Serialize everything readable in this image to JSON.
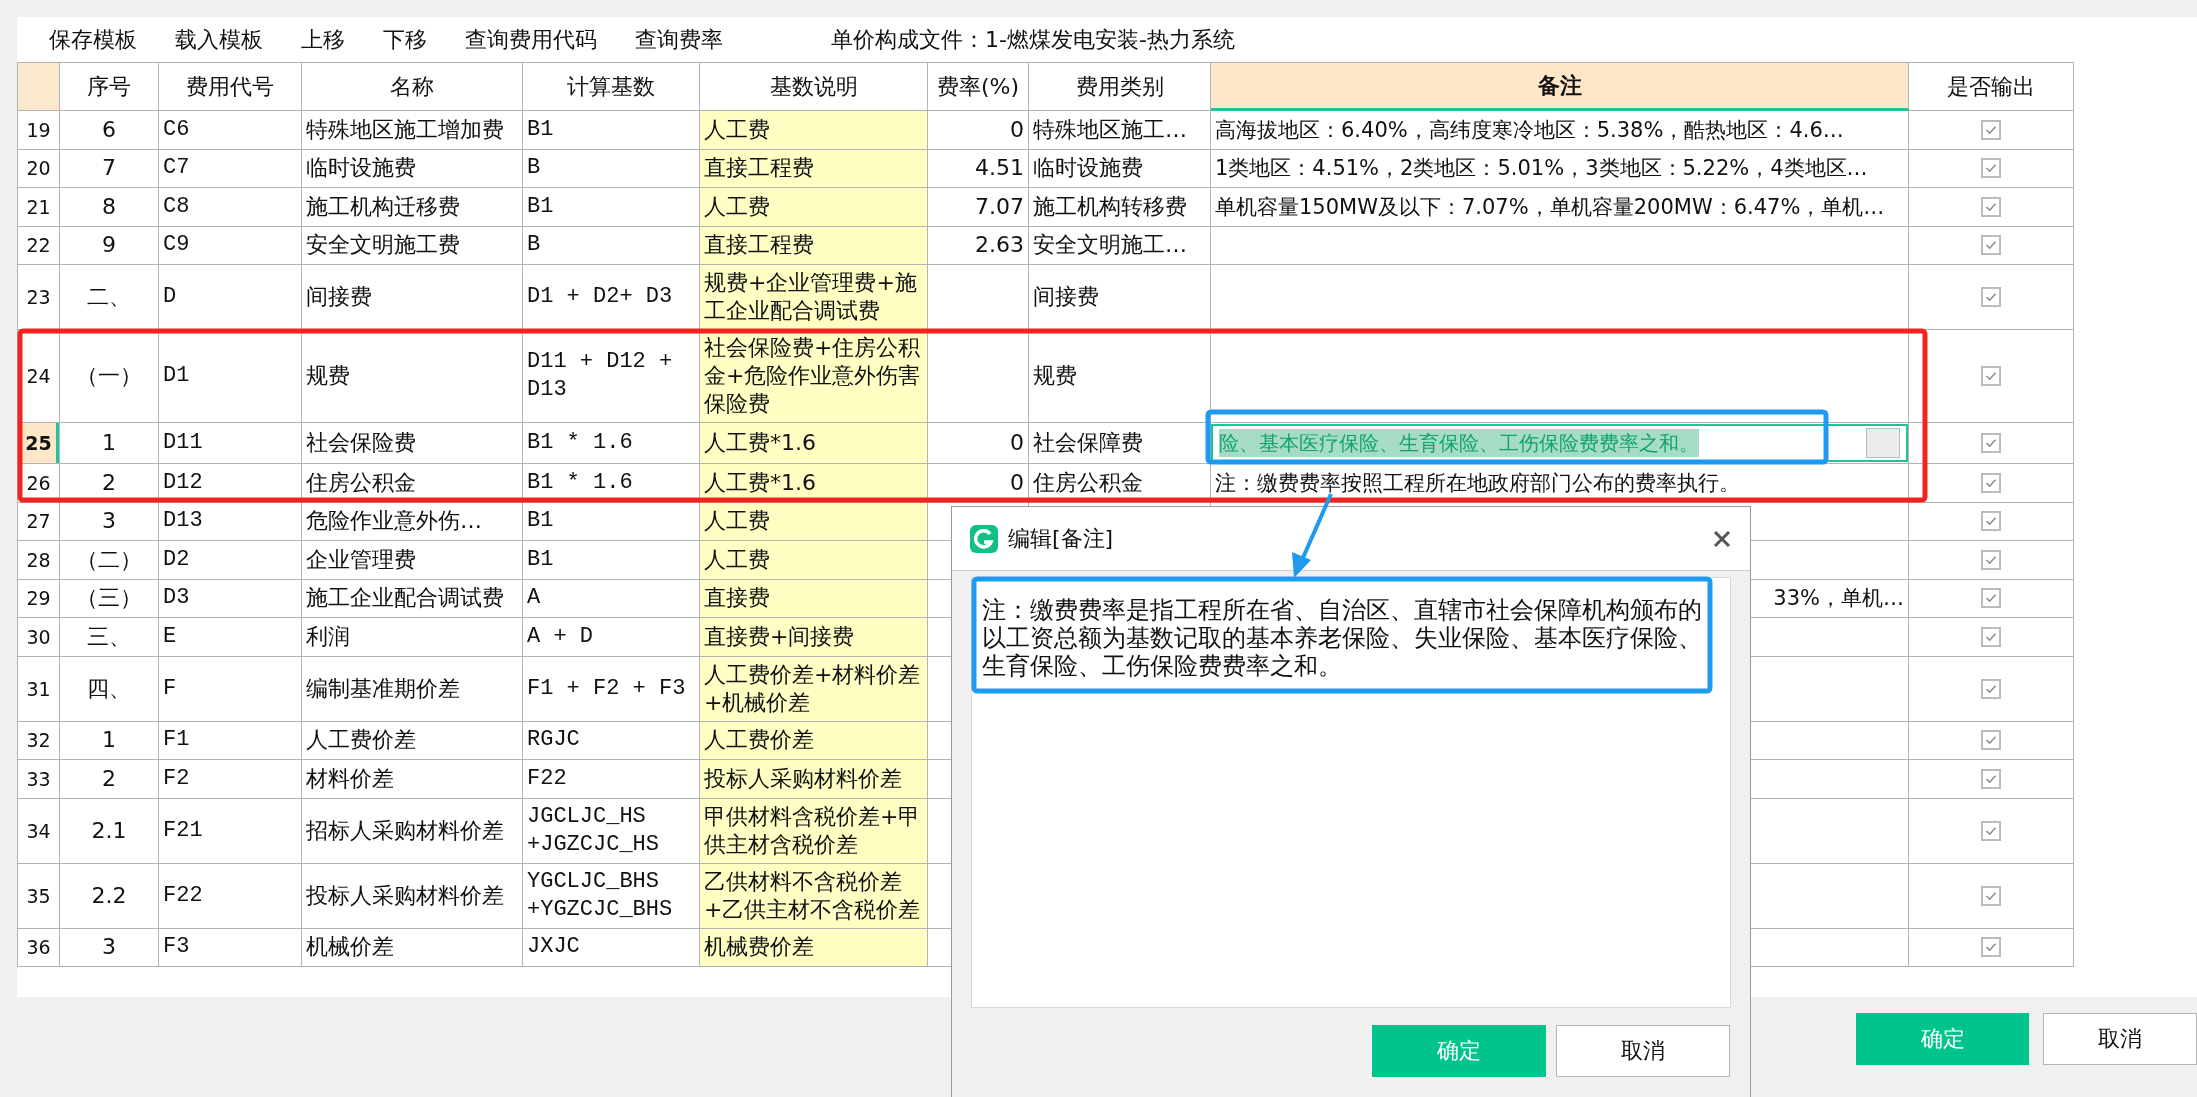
{
  "toolbar": {
    "buttons": [
      "保存模板",
      "载入模板",
      "上移",
      "下移",
      "查询费用代码",
      "查询费率"
    ],
    "file_label": "单价构成文件：1-燃煤发电安装-热力系统"
  },
  "table": {
    "columns": [
      {
        "label": "序号",
        "selected": false
      },
      {
        "label": "费用代号",
        "selected": false
      },
      {
        "label": "名称",
        "selected": false
      },
      {
        "label": "计算基数",
        "selected": false
      },
      {
        "label": "基数说明",
        "selected": false
      },
      {
        "label": "费率(%)",
        "selected": false
      },
      {
        "label": "费用类别",
        "selected": false
      },
      {
        "label": "备注",
        "selected": true
      },
      {
        "label": "是否输出",
        "selected": false
      }
    ],
    "rows": [
      {
        "n": "19",
        "seq": "6",
        "code": "C6",
        "name": "特殊地区施工增加费",
        "base": "B1",
        "base_desc": "人工费",
        "rate": "0",
        "category": "特殊地区施工…",
        "remark": "高海拔地区：6.40%，高纬度寒冷地区：5.38%，酷热地区：4.6…",
        "output": true,
        "selected": false
      },
      {
        "n": "20",
        "seq": "7",
        "code": "C7",
        "name": "临时设施费",
        "base": "B",
        "base_desc": "直接工程费",
        "rate": "4.51",
        "category": "临时设施费",
        "remark": "1类地区：4.51%，2类地区：5.01%，3类地区：5.22%，4类地区…",
        "output": true,
        "selected": false
      },
      {
        "n": "21",
        "seq": "8",
        "code": "C8",
        "name": "施工机构迁移费",
        "base": "B1",
        "base_desc": "人工费",
        "rate": "7.07",
        "category": "施工机构转移费",
        "remark": "单机容量150MW及以下：7.07%，单机容量200MW：6.47%，单机…",
        "output": true,
        "selected": false
      },
      {
        "n": "22",
        "seq": "9",
        "code": "C9",
        "name": "安全文明施工费",
        "base": "B",
        "base_desc": "直接工程费",
        "rate": "2.63",
        "category": "安全文明施工…",
        "output": true,
        "selected": false
      },
      {
        "n": "23",
        "seq": "二、",
        "code": "D",
        "name": "间接费",
        "base": "D1 + D2+ D3",
        "base_desc": "规费+企业管理费+施工企业配合调试费",
        "category": "间接费",
        "output": true,
        "selected": false
      },
      {
        "n": "24",
        "seq": "（一）",
        "code": "D1",
        "name": "规费",
        "base": "D11 + D12 + D13",
        "base_desc": "社会保险费+住房公积金+危险作业意外伤害保险费",
        "category": "规费",
        "output": true,
        "selected": false
      },
      {
        "n": "25",
        "seq": "1",
        "code": "D11",
        "name": "社会保险费",
        "base": "B1 * 1.6",
        "base_desc": "人工费*1.6",
        "rate": "0",
        "category": "社会保障费",
        "remark": "险、基本医疗保险、生育保险、工伤保险费费率之和。",
        "output": true,
        "selected": true
      },
      {
        "n": "26",
        "seq": "2",
        "code": "D12",
        "name": "住房公积金",
        "base": "B1 * 1.6",
        "base_desc": "人工费*1.6",
        "rate": "0",
        "category": "住房公积金",
        "remark": "注：缴费费率按照工程所在地政府部门公布的费率执行。",
        "output": true,
        "selected": false
      },
      {
        "n": "27",
        "seq": "3",
        "code": "D13",
        "name": "危险作业意外伤…",
        "base": "B1",
        "base_desc": "人工费",
        "output": true,
        "selected": false
      },
      {
        "n": "28",
        "seq": "（二）",
        "code": "D2",
        "name": "企业管理费",
        "base": "B1",
        "base_desc": "人工费",
        "output": true,
        "selected": false
      },
      {
        "n": "29",
        "seq": "（三）",
        "code": "D3",
        "name": "施工企业配合调试费",
        "base": "A",
        "base_desc": "直接费",
        "remark_tail": "33%，单机…",
        "output": true,
        "selected": false
      },
      {
        "n": "30",
        "seq": "三、",
        "code": "E",
        "name": "利润",
        "base": "A + D",
        "base_desc": "直接费+间接费",
        "output": true,
        "selected": false
      },
      {
        "n": "31",
        "seq": "四、",
        "code": "F",
        "name": "编制基准期价差",
        "base": "F1 + F2 + F3",
        "base_desc": "人工费价差+材料价差+机械价差",
        "output": true,
        "selected": false
      },
      {
        "n": "32",
        "seq": "1",
        "code": "F1",
        "name": "人工费价差",
        "base": "RGJC",
        "base_desc": "人工费价差",
        "output": true,
        "selected": false
      },
      {
        "n": "33",
        "seq": "2",
        "code": "F2",
        "name": "材料价差",
        "base": "F22",
        "base_desc": "投标人采购材料价差",
        "output": true,
        "selected": false
      },
      {
        "n": "34",
        "seq": "2.1",
        "code": "F21",
        "name": "招标人采购材料价差",
        "base": "JGCLJC_HS +JGZCJC_HS",
        "base_desc": "甲供材料含税价差+甲供主材含税价差",
        "output": true,
        "selected": false
      },
      {
        "n": "35",
        "seq": "2.2",
        "code": "F22",
        "name": "投标人采购材料价差",
        "base": "YGCLJC_BHS +YGZCJC_BHS",
        "base_desc": "乙供材料不含税价差+乙供主材不含税价差",
        "output": true,
        "selected": false
      },
      {
        "n": "36",
        "seq": "3",
        "code": "F3",
        "name": "机械价差",
        "base": "JXJC",
        "base_desc": "机械费价差",
        "output": true,
        "selected": false
      }
    ]
  },
  "footer": {
    "buttons": [
      {
        "label": "确定",
        "kind": "primary"
      },
      {
        "label": "取消",
        "kind": "secondary"
      }
    ]
  },
  "dialog": {
    "title": "编辑[备注]",
    "value": "注：缴费费率是指工程所在省、自治区、直辖市社会保障机构颁布的以工资总额为基数记取的基本养老保险、失业保险、基本医疗保险、生育保险、工伤保险费费率之和。",
    "buttons": [
      {
        "label": "确定",
        "kind": "primary"
      },
      {
        "label": "取消",
        "kind": "secondary"
      }
    ]
  }
}
